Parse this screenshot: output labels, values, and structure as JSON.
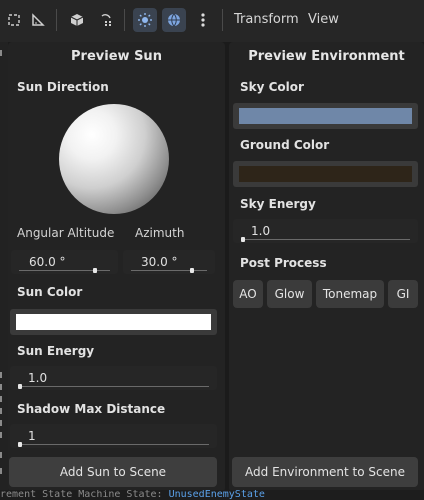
{
  "toolbar": {
    "menus": [
      "Transform",
      "View"
    ],
    "icons": [
      "select-icon",
      "ruler-icon",
      "cube-icon",
      "rotate-snap-icon",
      "sun-toggle-icon",
      "environment-toggle-icon",
      "more-options-icon"
    ]
  },
  "bottom_status": {
    "prefix": "rement State Machine State: ",
    "value": "UnusedEnemyState"
  },
  "sun_panel": {
    "title": "Preview Sun",
    "direction_label": "Sun Direction",
    "altitude_label": "Angular Altitude",
    "azimuth_label": "Azimuth",
    "altitude_value": "60.0 °",
    "azimuth_value": "30.0 °",
    "altitude_fraction": 0.85,
    "azimuth_fraction": 0.82,
    "color_label": "Sun Color",
    "color": "#ffffff",
    "energy_label": "Sun Energy",
    "energy_value": "1.0",
    "energy_fraction": 0.0,
    "shadow_label": "Shadow Max Distance",
    "shadow_value": "1",
    "shadow_fraction": 0.0,
    "add_button": "Add Sun to Scene"
  },
  "env_panel": {
    "title": "Preview Environment",
    "sky_color_label": "Sky Color",
    "sky_color": "#6f87a8",
    "ground_color_label": "Ground Color",
    "ground_color": "#2e2519",
    "sky_energy_label": "Sky Energy",
    "sky_energy_value": "1.0",
    "sky_energy_fraction": 0.0,
    "post_process_label": "Post Process",
    "post_buttons": [
      "AO",
      "Glow",
      "Tonemap",
      "GI"
    ],
    "add_button": "Add Environment to Scene"
  }
}
